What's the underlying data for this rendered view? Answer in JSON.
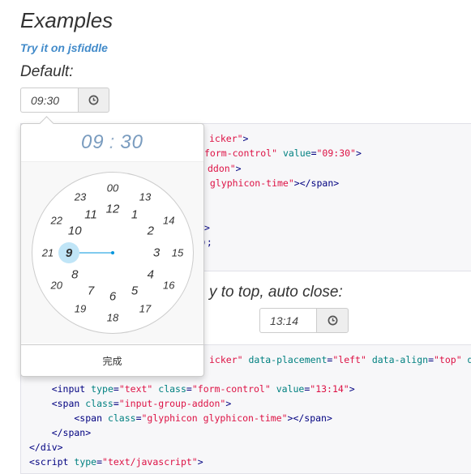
{
  "heading": "Examples",
  "link_text": "Try it on jsfiddle",
  "default_heading": "Default:",
  "default_input": {
    "value": "09:30",
    "icon": "time-icon"
  },
  "second_heading": "y to top, auto close:",
  "second_input": {
    "value": "13:14",
    "icon": "time-icon"
  },
  "code_block_1": {
    "lines": [
      {
        "parts": [
          [
            "str",
            "icker\""
          ],
          [
            "tag",
            ">"
          ]
        ]
      },
      {
        "parts": [
          [
            "str",
            "form-control\""
          ],
          [
            "attr",
            " value"
          ],
          [
            "tag",
            "="
          ],
          [
            "str",
            "\"09:30\""
          ],
          [
            "tag",
            ">"
          ]
        ]
      },
      {
        "parts": [
          [
            "str",
            "ddon\""
          ],
          [
            "tag",
            ">"
          ]
        ]
      },
      {
        "parts": [
          [
            "str",
            " glyphicon-time\""
          ],
          [
            "tag",
            "></span>"
          ]
        ]
      },
      {
        "parts": [
          [
            "tag",
            ""
          ]
        ]
      },
      {
        "parts": [
          [
            "tag",
            ""
          ]
        ]
      },
      {
        "parts": [
          [
            "tag",
            ">"
          ]
        ]
      },
      {
        "parts": [
          [
            "tag",
            ");"
          ]
        ]
      }
    ]
  },
  "code_block_2": {
    "lines": [
      {
        "parts": [
          [
            "str",
            "icker\""
          ],
          [
            "attr",
            " data-placement"
          ],
          [
            "tag",
            "="
          ],
          [
            "str",
            "\"left\""
          ],
          [
            "attr",
            " data-align"
          ],
          [
            "tag",
            "="
          ],
          [
            "str",
            "\"top\""
          ],
          [
            "attr",
            " d"
          ]
        ]
      },
      {
        "parts": [
          [
            "tag",
            "    <input"
          ],
          [
            "attr",
            " type"
          ],
          [
            "tag",
            "="
          ],
          [
            "str",
            "\"text\""
          ],
          [
            "attr",
            " class"
          ],
          [
            "tag",
            "="
          ],
          [
            "str",
            "\"form-control\""
          ],
          [
            "attr",
            " value"
          ],
          [
            "tag",
            "="
          ],
          [
            "str",
            "\"13:14\""
          ],
          [
            "tag",
            ">"
          ]
        ]
      },
      {
        "parts": [
          [
            "tag",
            "    <span"
          ],
          [
            "attr",
            " class"
          ],
          [
            "tag",
            "="
          ],
          [
            "str",
            "\"input-group-addon\""
          ],
          [
            "tag",
            ">"
          ]
        ]
      },
      {
        "parts": [
          [
            "tag",
            "        <span"
          ],
          [
            "attr",
            " class"
          ],
          [
            "tag",
            "="
          ],
          [
            "str",
            "\"glyphicon glyphicon-time\""
          ],
          [
            "tag",
            "></span>"
          ]
        ]
      },
      {
        "parts": [
          [
            "tag",
            "    </span>"
          ]
        ]
      },
      {
        "parts": [
          [
            "tag",
            "</div>"
          ]
        ]
      },
      {
        "parts": [
          [
            "tag",
            "<script"
          ],
          [
            "attr",
            " type"
          ],
          [
            "tag",
            "="
          ],
          [
            "str",
            "\"text/javascript\""
          ],
          [
            "tag",
            ">"
          ]
        ]
      }
    ]
  },
  "clockpicker": {
    "hours": "09",
    "separator": ":",
    "minutes": "30",
    "selected": "9",
    "outer_ticks": [
      "00",
      "13",
      "14",
      "15",
      "16",
      "17",
      "18",
      "19",
      "20",
      "21",
      "22",
      "23"
    ],
    "inner_ticks": [
      "12",
      "1",
      "2",
      "3",
      "4",
      "5",
      "6",
      "7",
      "8",
      "9",
      "10",
      "11"
    ],
    "done_label": "完成",
    "colors": {
      "accent": "#0095dd",
      "selected_bg": "#c0e5f7",
      "title": "#7a9cbf"
    }
  }
}
